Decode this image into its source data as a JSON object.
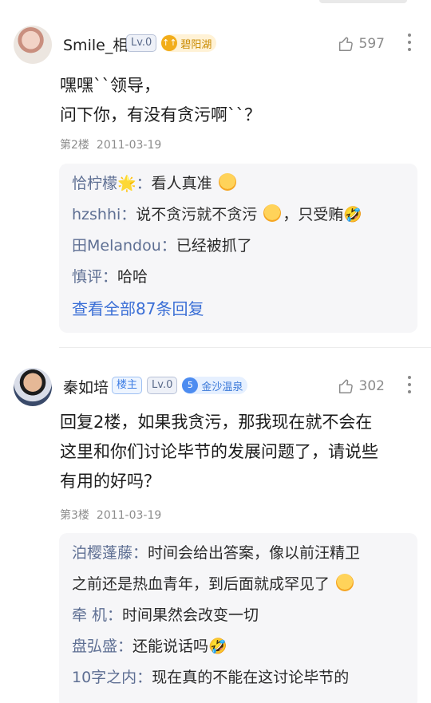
{
  "posts": [
    {
      "username": "Smile_相",
      "level": "Lv.0",
      "bar_badge": {
        "icon": "↑↑",
        "name": "碧阳湖"
      },
      "likes": "597",
      "content_lines": [
        "嘿嘿``领导，",
        "问下你，有没有贪污啊``？"
      ],
      "floor": "第2楼",
      "date": "2011-03-19",
      "replies": [
        {
          "user": "恰柠檬🌟：",
          "text": "看人真准",
          "emoji": true
        },
        {
          "user": "hzshhi：",
          "text": "说不贪污就不贪污",
          "emoji": true,
          "tail": "，只受贿🤣"
        },
        {
          "user": "田Melandou：",
          "text": "已经被抓了"
        },
        {
          "user": "慎评：",
          "text": "哈哈"
        }
      ],
      "view_all": "查看全部87条回复"
    },
    {
      "username": "秦如培",
      "host_label": "楼主",
      "level": "Lv.0",
      "bar_badge": {
        "icon": "5",
        "name": "金沙温泉"
      },
      "likes": "302",
      "content_lines": [
        "回复2楼，如果我贪污，那我现在就不会在",
        "这里和你们讨论毕节的发展问题了，请说些",
        "有用的好吗？"
      ],
      "floor": "第3楼",
      "date": "2011-03-19",
      "replies": [
        {
          "user": "泊樱蓬藤：",
          "text": "时间会给出答案，像以前汪精卫"
        },
        {
          "user": "",
          "text": "之前还是热血青年，到后面就成罕见了",
          "emoji": true
        },
        {
          "user": "牵 机：",
          "text": "时间果然会改变一切"
        },
        {
          "user": "盘弘盛：",
          "text": "还能说话吗🤣"
        },
        {
          "user": "10字之内：",
          "text": "现在真的不能在这讨论毕节的"
        }
      ]
    }
  ],
  "icons": {
    "like": "thumbs-up-icon",
    "more": "more-vertical-icon"
  },
  "colors": {
    "username_blue": "#5e6f93",
    "link_blue": "#3b6fd6"
  }
}
